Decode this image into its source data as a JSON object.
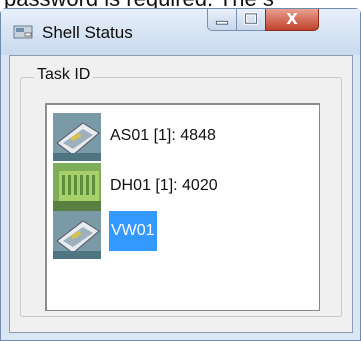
{
  "background_text": "password is required. The s",
  "window": {
    "title": "Shell Status",
    "close_glyph": "X"
  },
  "group": {
    "label": "Task ID"
  },
  "tasks": [
    {
      "label": "AS01 [1]: 4848",
      "icon": "network-card-icon",
      "selected": false
    },
    {
      "label": "DH01 [1]: 4020",
      "icon": "memory-module-icon",
      "selected": false
    },
    {
      "label": "VW01",
      "icon": "network-card-icon",
      "selected": true
    }
  ],
  "colors": {
    "selection": "#3399ff",
    "close_button": "#c0412a",
    "frame": "#dbe6f3"
  }
}
